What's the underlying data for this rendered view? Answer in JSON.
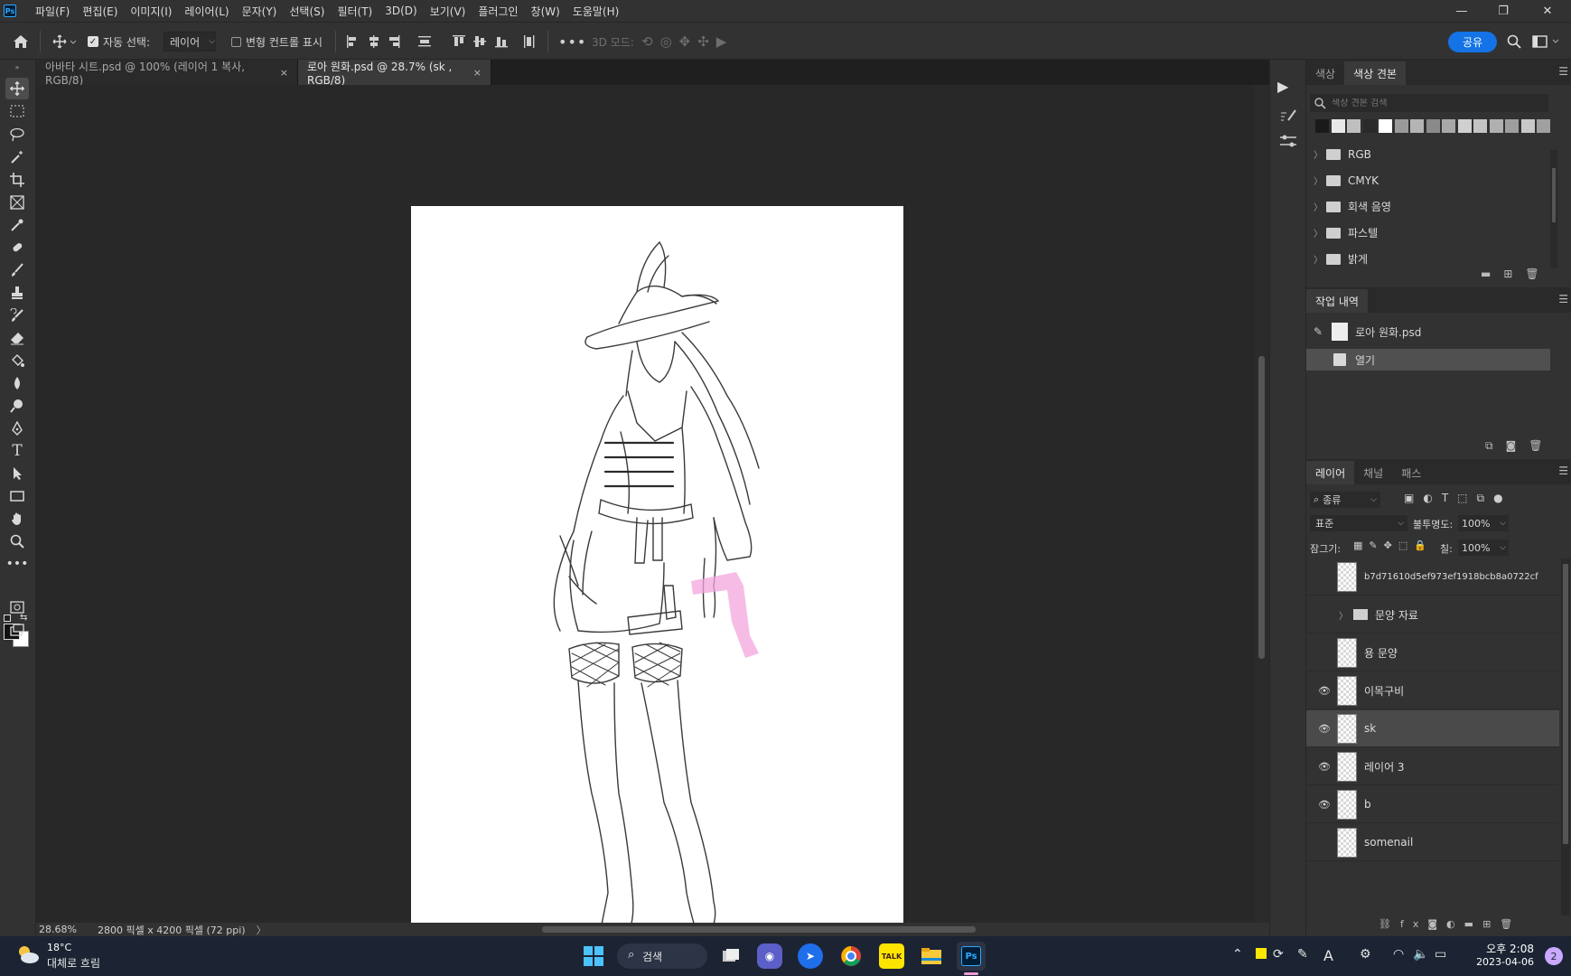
{
  "menu": {
    "items": [
      "파일(F)",
      "편집(E)",
      "이미지(I)",
      "레이어(L)",
      "문자(Y)",
      "선택(S)",
      "필터(T)",
      "3D(D)",
      "보기(V)",
      "플러그인",
      "창(W)",
      "도움말(H)"
    ],
    "logo": "Ps"
  },
  "window": {
    "minimize": "—",
    "restore": "❐",
    "close": "✕"
  },
  "options": {
    "auto_select_label": "자동 선택:",
    "auto_select_value": "레이어",
    "transform_controls_label": "변형 컨트롤 표시",
    "mode_3d_label": "3D 모드:",
    "share_label": "공유"
  },
  "tabs": [
    {
      "title": "아바타 시트.psd @ 100% (레이어 1 복사, RGB/8)",
      "close": "×"
    },
    {
      "title": "로아 원화.psd @ 28.7% (sk , RGB/8)",
      "close": "×"
    }
  ],
  "status": {
    "zoom": "28.68%",
    "dimensions": "2800 픽셀 x 4200 픽셀 (72 ppi)",
    "arrow": "〉"
  },
  "swatches_panel": {
    "tabs": [
      "색상",
      "색상 견본"
    ],
    "search_placeholder": "색상 견본 검색",
    "swatch_colors": [
      "#1a1a1a",
      "#e8e8e8",
      "#bfbfbf",
      "#2a2a2a",
      "#ffffff",
      "#9a9a9a",
      "#b4b4b4",
      "#8a8a8a",
      "#a8a8a8",
      "#d0d0d0",
      "#c4c4c4",
      "#b0b0b0",
      "#9e9e9e",
      "#c8c8c8",
      "#a0a0a0"
    ],
    "folders": [
      "RGB",
      "CMYK",
      "회색 음영",
      "파스텔",
      "밝게"
    ]
  },
  "history_panel": {
    "tab": "작업 내역",
    "items": [
      "로아 원화.psd",
      "열기"
    ]
  },
  "layers_panel": {
    "tabs": [
      "레이어",
      "채널",
      "패스"
    ],
    "filter_label": "종류",
    "blend_mode": "표준",
    "opacity_label": "불투명도:",
    "opacity_value": "100%",
    "lock_label": "잠그기:",
    "fill_label": "칠:",
    "fill_value": "100%",
    "layers": [
      {
        "name": "b7d71610d5ef973ef1918bcb8a0722cf",
        "visible": false,
        "selected": false,
        "group": false
      },
      {
        "name": "문양 자료",
        "visible": false,
        "selected": false,
        "group": true
      },
      {
        "name": "용 문양",
        "visible": false,
        "selected": false,
        "group": false
      },
      {
        "name": "이목구비",
        "visible": true,
        "selected": false,
        "group": false
      },
      {
        "name": "sk",
        "visible": true,
        "selected": true,
        "group": false
      },
      {
        "name": "레이어 3",
        "visible": true,
        "selected": false,
        "group": false
      },
      {
        "name": "b",
        "visible": true,
        "selected": false,
        "group": false
      },
      {
        "name": "somenail",
        "visible": false,
        "selected": false,
        "group": false
      }
    ]
  },
  "taskbar": {
    "weather_temp": "18°C",
    "weather_desc": "대체로 흐림",
    "search_label": "검색",
    "time": "오후 2:08",
    "date": "2023-04-06",
    "notification_count": "2",
    "ime": "A"
  }
}
